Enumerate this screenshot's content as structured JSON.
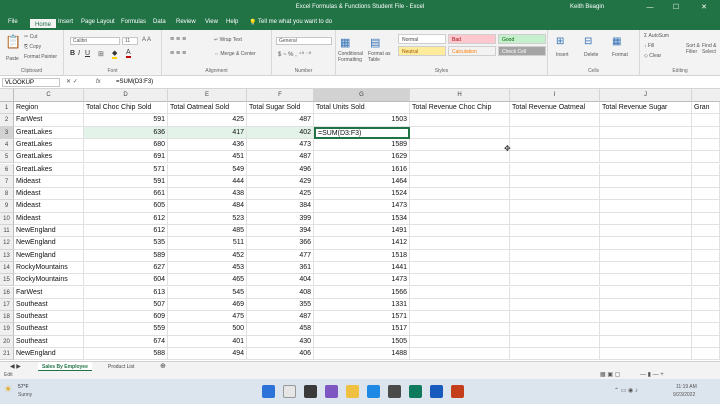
{
  "titlebar": {
    "title": "Excel Formulas & Functions Student File  -  Excel",
    "user": "Keith Beagin",
    "minimize": "—",
    "maximize": "☐",
    "close": "✕"
  },
  "menu": [
    "File",
    "Home",
    "Insert",
    "Page Layout",
    "Formulas",
    "Data",
    "Review",
    "View",
    "Help",
    "Tell me what you want to do"
  ],
  "ribbon": {
    "clipboard": {
      "cut": "Cut",
      "copy": "Copy",
      "painter": "Format Painter",
      "paste": "Paste",
      "label": "Clipboard"
    },
    "font": {
      "name": "Calibri",
      "size": "11",
      "label": "Font"
    },
    "alignment": {
      "wrap": "Wrap Text",
      "merge": "Merge & Center",
      "label": "Alignment"
    },
    "number": {
      "format": "General",
      "label": "Number"
    },
    "styles": {
      "cond": "Conditional Formatting",
      "fmt": "Format as Table",
      "normal": "Normal",
      "bad": "Bad",
      "good": "Good",
      "neutral": "Neutral",
      "calculation": "Calculation",
      "checkcell": "Check Cell",
      "label": "Styles"
    },
    "cells": {
      "insert": "Insert",
      "delete": "Delete",
      "format": "Format",
      "label": "Cells"
    },
    "editing": {
      "autosum": "AutoSum",
      "fill": "Fill",
      "clear": "Clear",
      "sort": "Sort & Filter",
      "find": "Find & Select",
      "label": "Editing"
    }
  },
  "formula_bar": {
    "name_box": "VLOOKUP",
    "content": "=SUM(D3:F3)"
  },
  "columns": [
    "C",
    "D",
    "E",
    "F",
    "G",
    "H",
    "I",
    "J"
  ],
  "rows": [
    {
      "n": "1",
      "c": "Region",
      "d": "Total Choc Chip Sold",
      "e": "Total Oatmeal Sold",
      "f": "Total Sugar Sold",
      "g": "Total Units Sold",
      "h": "Total Revenue Choc Chip",
      "i": "Total Revenue Oatmeal",
      "j": "Total Revenue Sugar",
      "k": "Gran"
    },
    {
      "n": "2",
      "c": "FarWest",
      "d": "591",
      "e": "425",
      "f": "487",
      "g": "1503"
    },
    {
      "n": "3",
      "c": "GreatLakes",
      "d": "636",
      "e": "417",
      "f": "402",
      "g": "=SUM(D3:F3)"
    },
    {
      "n": "4",
      "c": "GreatLakes",
      "d": "680",
      "e": "436",
      "f": "473",
      "g": "1589"
    },
    {
      "n": "5",
      "c": "GreatLakes",
      "d": "691",
      "e": "451",
      "f": "487",
      "g": "1629"
    },
    {
      "n": "6",
      "c": "GreatLakes",
      "d": "571",
      "e": "549",
      "f": "496",
      "g": "1616"
    },
    {
      "n": "7",
      "c": "Mideast",
      "d": "591",
      "e": "444",
      "f": "429",
      "g": "1464"
    },
    {
      "n": "8",
      "c": "Mideast",
      "d": "661",
      "e": "438",
      "f": "425",
      "g": "1524"
    },
    {
      "n": "9",
      "c": "Mideast",
      "d": "605",
      "e": "484",
      "f": "384",
      "g": "1473"
    },
    {
      "n": "10",
      "c": "Mideast",
      "d": "612",
      "e": "523",
      "f": "399",
      "g": "1534"
    },
    {
      "n": "11",
      "c": "NewEngland",
      "d": "612",
      "e": "485",
      "f": "394",
      "g": "1491"
    },
    {
      "n": "12",
      "c": "NewEngland",
      "d": "535",
      "e": "511",
      "f": "366",
      "g": "1412"
    },
    {
      "n": "13",
      "c": "NewEngland",
      "d": "589",
      "e": "452",
      "f": "477",
      "g": "1518"
    },
    {
      "n": "14",
      "c": "RockyMountains",
      "d": "627",
      "e": "453",
      "f": "361",
      "g": "1441"
    },
    {
      "n": "15",
      "c": "RockyMountains",
      "d": "604",
      "e": "465",
      "f": "404",
      "g": "1473"
    },
    {
      "n": "16",
      "c": "FarWest",
      "d": "613",
      "e": "545",
      "f": "408",
      "g": "1566"
    },
    {
      "n": "17",
      "c": "Southeast",
      "d": "507",
      "e": "469",
      "f": "355",
      "g": "1331"
    },
    {
      "n": "18",
      "c": "Southeast",
      "d": "609",
      "e": "475",
      "f": "487",
      "g": "1571"
    },
    {
      "n": "19",
      "c": "Southeast",
      "d": "559",
      "e": "500",
      "f": "458",
      "g": "1517"
    },
    {
      "n": "20",
      "c": "Southeast",
      "d": "674",
      "e": "401",
      "f": "430",
      "g": "1505"
    },
    {
      "n": "21",
      "c": "NewEngland",
      "d": "588",
      "e": "494",
      "f": "406",
      "g": "1488"
    }
  ],
  "sheets": [
    "Sales By Employee",
    "Product List"
  ],
  "status": {
    "mode": "Edit"
  },
  "taskbar": {
    "temp": "57°F",
    "weather": "Sunny",
    "time": "11:19 AM",
    "date": "9/23/2022"
  }
}
